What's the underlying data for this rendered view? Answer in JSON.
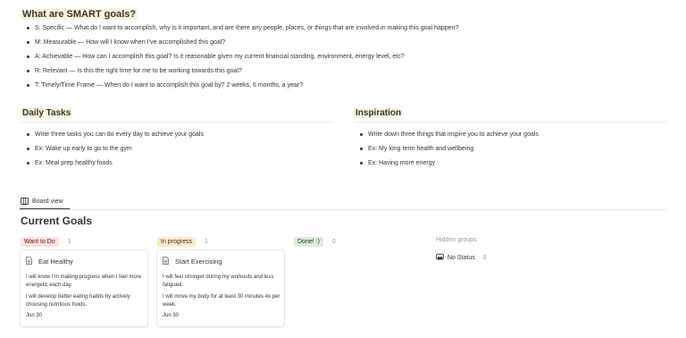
{
  "smart": {
    "title": "What are SMART goals?",
    "items": [
      "S: Specific — What do I want to accomplish, why is it important, and are there any people, places, or things that are involved in making this goal happen?",
      "M: Measurable — How will I know when I’ve accomplished this goal?",
      "A: Achievable — How can I accomplish this goal? Is it reasonable given my current financial standing, environment, energy level, etc?",
      "R: Relevant — Is this the right time for me to be working towards this goal?",
      "T: Timely/Time Frame — When do I want to accomplish this goal by? 2 weeks, 6 months, a year?"
    ]
  },
  "daily": {
    "title": "Daily Tasks",
    "items": [
      "Write three tasks you can do every day to achieve your goals",
      "Ex: Wake up early to go to the gym",
      "Ex: Meal prep healthy foods"
    ]
  },
  "inspiration": {
    "title": "Inspiration",
    "items": [
      "Write down three things that inspire you to achieve your goals",
      "Ex: My long term health and wellbeing",
      "Ex: Having more energy"
    ]
  },
  "view": {
    "label": "Board view",
    "icon": "board-icon"
  },
  "board": {
    "title": "Current Goals",
    "groups": [
      {
        "label": "Want to Do",
        "count": "1",
        "bg": "#ffe2dd",
        "fg": "#5d1715"
      },
      {
        "label": "In progress",
        "count": "1",
        "bg": "#fdecc8",
        "fg": "#402c1b"
      },
      {
        "label": "Done! :)",
        "count": "0",
        "bg": "#dbeddb",
        "fg": "#1c3829"
      }
    ],
    "cards": [
      {
        "title": "Eat Healthy",
        "p1": "I will know I’m making progress when I feel more energetic each day.",
        "p2": "I will develop better eating habits by actively choosing nutritious foods.",
        "date": "Jun 30"
      },
      {
        "title": "Start Exercising",
        "p1": "I will feel stronger during my workouts and less fatigued.",
        "p2": "I will move my body for at least 30 minutes 4x per week.",
        "date": "Jun 30"
      }
    ],
    "hidden": {
      "label": "Hidden groups",
      "no_status": "No Status",
      "count": "0",
      "icon": "eye-off-icon"
    }
  },
  "colors": {
    "text": "#37352f",
    "muted": "#9b9a97",
    "highlight": "#fbf3db"
  }
}
